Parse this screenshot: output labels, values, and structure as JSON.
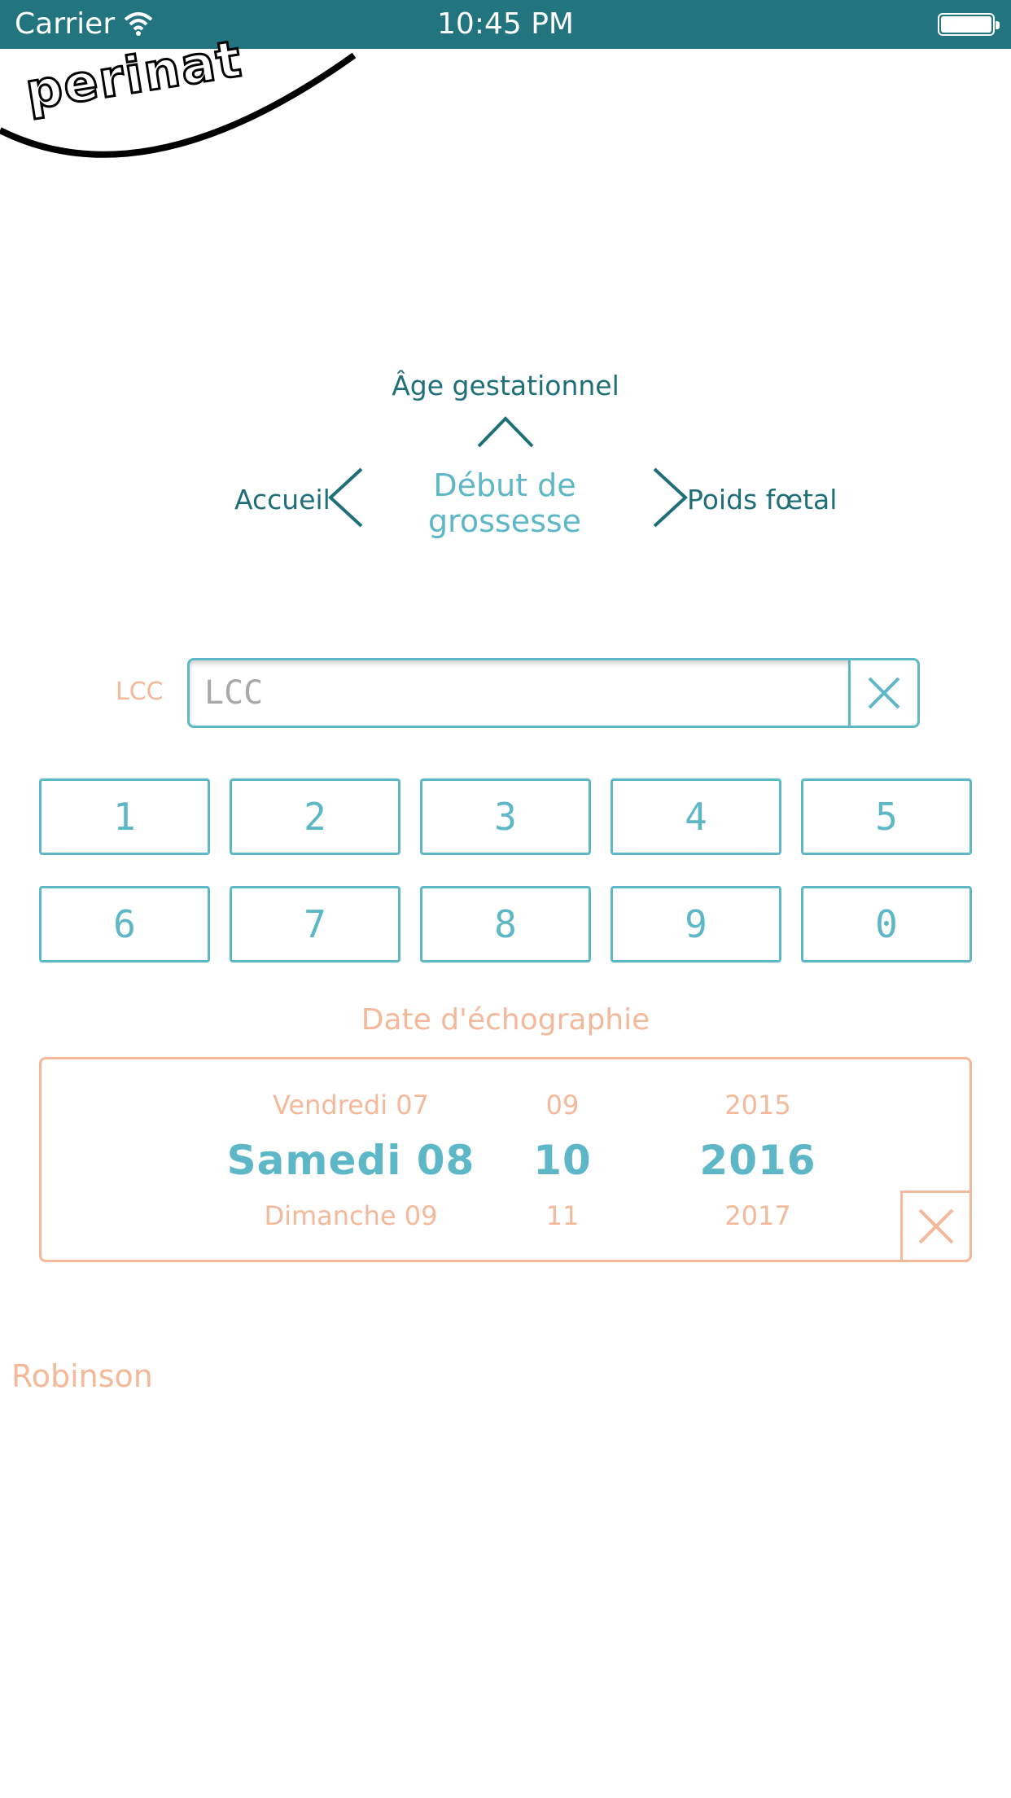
{
  "status_bar": {
    "carrier": "Carrier",
    "time": "10:45 PM"
  },
  "logo": {
    "text": "perinat"
  },
  "nav": {
    "up_label": "Âge gestationnel",
    "current_line1": "Début de",
    "current_line2": "grossesse",
    "left_label": "Accueil",
    "right_label": "Poids fœtal"
  },
  "lcc": {
    "label": "LCC",
    "placeholder": "LCC",
    "value": ""
  },
  "keypad": {
    "keys": [
      "1",
      "2",
      "3",
      "4",
      "5",
      "6",
      "7",
      "8",
      "9",
      "0"
    ]
  },
  "date": {
    "title": "Date d'échographie",
    "day": {
      "prev": "Vendredi 07",
      "selected": "Samedi 08",
      "next": "Dimanche 09"
    },
    "month": {
      "prev": "09",
      "selected": "10",
      "next": "11"
    },
    "year": {
      "prev": "2015",
      "selected": "2016",
      "next": "2017"
    }
  },
  "method": {
    "label": "Robinson"
  },
  "colors": {
    "teal_dark": "#22757e",
    "teal": "#5db7c6",
    "peach": "#f4b89a"
  }
}
